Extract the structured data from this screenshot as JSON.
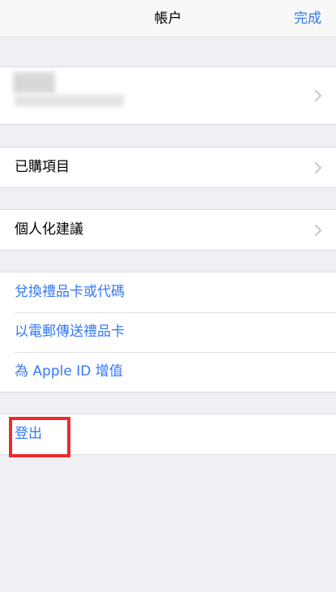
{
  "navbar": {
    "title": "帳户",
    "done_label": "完成"
  },
  "account": {
    "name": "",
    "chevron_icon": "chevron-right-icon"
  },
  "items": {
    "purchased": "已購項目",
    "recommendations": "個人化建議",
    "redeem": "兌換禮品卡或代碼",
    "email_gift": "以電郵傳送禮品卡",
    "add_funds": "為 Apple ID 增值",
    "sign_out": "登出"
  },
  "colors": {
    "accent": "#3478f6",
    "highlight": "#ee2a2a",
    "background": "#efeff4"
  }
}
